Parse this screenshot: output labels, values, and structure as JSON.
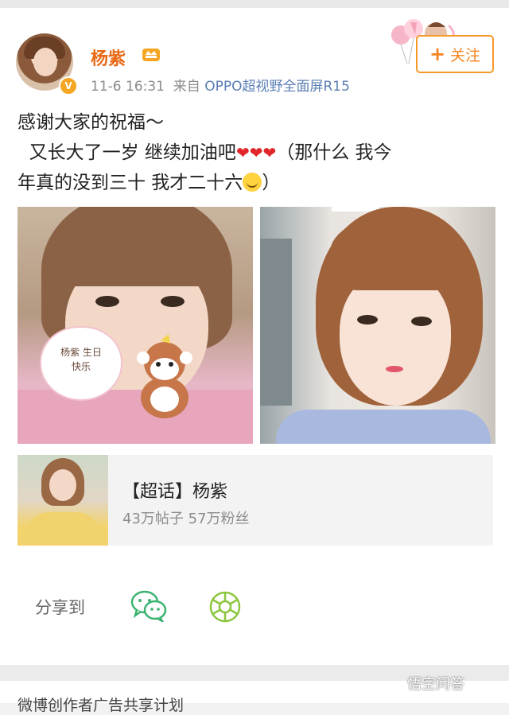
{
  "post": {
    "author": "杨紫",
    "time": "11-6 16:31",
    "source_prefix": "来自",
    "source_device": "OPPO超视野全面屏R15",
    "follow_label": "关注",
    "verified_badge": "V",
    "text_line1": "感谢大家的祝福～",
    "text_line2_a": "又长大了一岁 继续加油吧",
    "hearts": "❤❤❤",
    "text_line2_b": "（那什么 我今",
    "text_line3": "年真的没到三十 我才二十六",
    "text_line3_end": "）"
  },
  "photos": [
    {
      "sign_text": "杨紫 生日快乐"
    },
    {}
  ],
  "super_topic": {
    "title": "【超话】杨紫",
    "stats": "43万帖子 57万粉丝"
  },
  "share": {
    "label": "分享到",
    "targets": [
      "wechat-icon",
      "moments-icon"
    ]
  },
  "footer": {
    "next_post_text": "微博创作者广告共享计划",
    "watermark": "悟空问答"
  },
  "colors": {
    "accent": "#f5831f",
    "author": "#e86a17",
    "link": "#5b7fb5",
    "wechat": "#3cb371",
    "moments": "#8cc63f"
  }
}
